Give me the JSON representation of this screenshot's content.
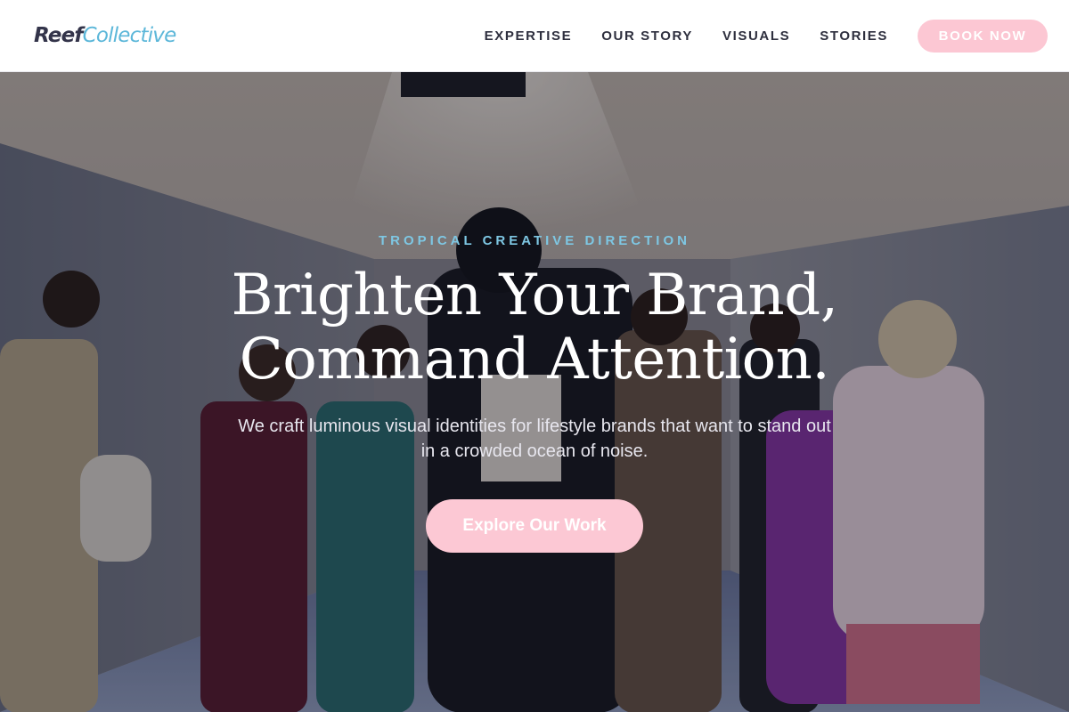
{
  "brand": {
    "logo_part1": "Reef",
    "logo_part2": "Collective",
    "accent_color": "#5cb7d9",
    "pink_color": "#fcc7d3"
  },
  "nav": {
    "items": [
      {
        "label": "EXPERTISE"
      },
      {
        "label": "OUR STORY"
      },
      {
        "label": "VISUALS"
      },
      {
        "label": "STORIES"
      }
    ],
    "cta_label": "BOOK NOW"
  },
  "hero": {
    "eyebrow": "TROPICAL CREATIVE DIRECTION",
    "headline_line1": "Brighten Your Brand,",
    "headline_line2": "Command Attention.",
    "subtext": "We craft luminous visual identities for lifestyle brands that want to stand out in a crowded ocean of noise.",
    "cta_label": "Explore Our Work",
    "background_image": "group-fashion-photo"
  }
}
